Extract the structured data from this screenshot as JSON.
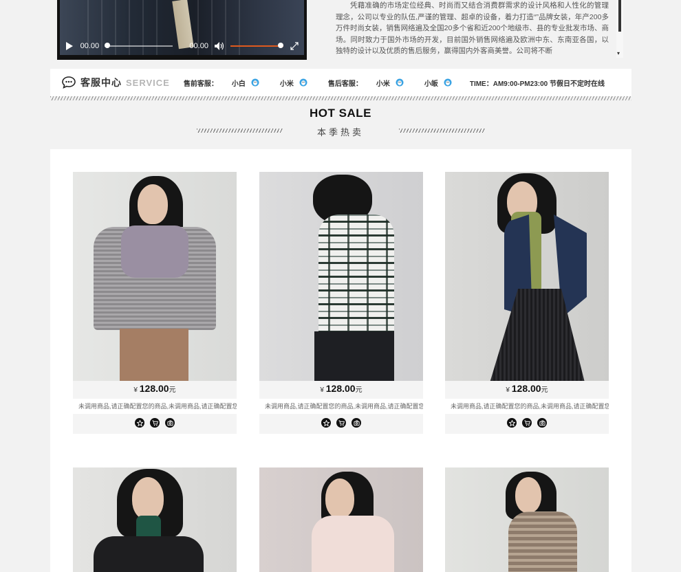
{
  "intro_text": "凭藉准确的市场定位经典、时尚而又结合消费群需求的设计风格和人性化的管理理念，公司以专业的队伍,严谨的管理、超卓的设备，着力打造“”品牌女装，年产200多万件时尚女装，销售网络遍及全国20多个省和近200个地级市、县的专业批发市场、商场。同时致力于国外市场的开发，目前国外销售网络遍及欧洲中东、东南亚各国，以独特的设计以及优质的售后服务，赢得国内外客商美誉。公司将不断",
  "video": {
    "time_current": "00.00",
    "time_total": "00.00",
    "progress": 0,
    "volume": 1
  },
  "service": {
    "title": "客服中心",
    "title_en": "SERVICE",
    "presale_label": "售前客服：",
    "aftersale_label": "售后客服：",
    "presale": [
      "小白",
      "小米"
    ],
    "aftersale": [
      "小米",
      "小皈"
    ],
    "time": "TIME：AM9:00-PM23:00 节假日不定时在线"
  },
  "hot_sale": {
    "title": "HOT SALE",
    "subtitle": "本季热卖"
  },
  "products": [
    {
      "currency": "¥",
      "price": "128.00",
      "unit": "元",
      "desc": "未调用商品,请正确配置您的商品,未调用商品,请正确配置您的"
    },
    {
      "currency": "¥",
      "price": "128.00",
      "unit": "元",
      "desc": "未调用商品,请正确配置您的商品,未调用商品,请正确配置您的"
    },
    {
      "currency": "¥",
      "price": "128.00",
      "unit": "元",
      "desc": "未调用商品,请正确配置您的商品,未调用商品,请正确配置您的"
    }
  ],
  "icons": {
    "action_favorite": "star-icon",
    "action_cart": "cart-icon",
    "action_share": "share-icon"
  },
  "colors": {
    "volume_accent": "#e05a1e",
    "qq_blue": "#3aa3e3"
  }
}
